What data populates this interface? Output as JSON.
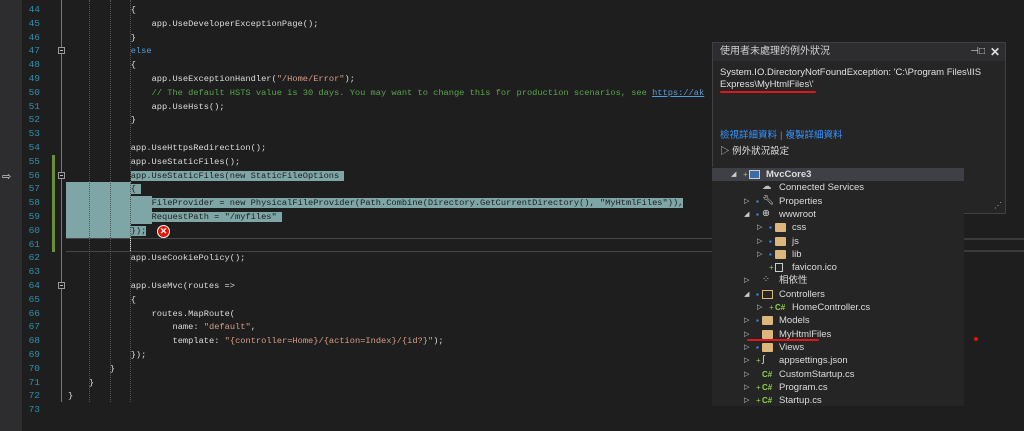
{
  "editor": {
    "lines": [
      {
        "n": "44",
        "indent": 3,
        "tokens": [
          [
            "",
            "{"
          ]
        ]
      },
      {
        "n": "45",
        "indent": 4,
        "tokens": [
          [
            "",
            "app.UseDeveloperExceptionPage();"
          ]
        ]
      },
      {
        "n": "46",
        "indent": 3,
        "tokens": [
          [
            "",
            "}"
          ]
        ]
      },
      {
        "n": "47",
        "indent": 3,
        "tokens": [
          [
            "kw",
            "else"
          ]
        ]
      },
      {
        "n": "48",
        "indent": 3,
        "tokens": [
          [
            "",
            "{"
          ]
        ]
      },
      {
        "n": "49",
        "indent": 4,
        "tokens": [
          [
            "",
            "app.UseExceptionHandler("
          ],
          [
            "str",
            "\"/Home/Error\""
          ],
          [
            "",
            ");"
          ]
        ]
      },
      {
        "n": "50",
        "indent": 4,
        "tokens": [
          [
            "cm",
            "// The default HSTS value is 30 days. You may want to change this for production scenarios, see "
          ],
          [
            "lnk",
            "https://ak"
          ]
        ]
      },
      {
        "n": "51",
        "indent": 4,
        "tokens": [
          [
            "",
            "app.UseHsts();"
          ]
        ]
      },
      {
        "n": "52",
        "indent": 3,
        "tokens": [
          [
            "",
            "}"
          ]
        ]
      },
      {
        "n": "53",
        "indent": 3,
        "tokens": []
      },
      {
        "n": "54",
        "indent": 3,
        "tokens": [
          [
            "",
            "app.UseHttpsRedirection();"
          ]
        ]
      },
      {
        "n": "55",
        "indent": 3,
        "tokens": [
          [
            "",
            "app.UseStaticFiles();"
          ]
        ]
      },
      {
        "n": "56",
        "indent": 3,
        "sel": true,
        "tokens": [
          [
            "",
            "app.UseStaticFiles("
          ],
          [
            "kw",
            "new"
          ],
          [
            "",
            " StaticFileOptions "
          ]
        ]
      },
      {
        "n": "57",
        "indent": 3,
        "sel": true,
        "tokens": [
          [
            "",
            "{ "
          ]
        ]
      },
      {
        "n": "58",
        "indent": 4,
        "sel": true,
        "tokens": [
          [
            "",
            "FileProvider = "
          ],
          [
            "kw",
            "new"
          ],
          [
            "",
            " PhysicalFileProvider(Path.Combine(Directory.GetCurrentDirectory(), "
          ],
          [
            "str",
            "\"MyHtmlFiles\""
          ],
          [
            "",
            ")),"
          ]
        ]
      },
      {
        "n": "59",
        "indent": 4,
        "sel": true,
        "tokens": [
          [
            "",
            "RequestPath = "
          ],
          [
            "str",
            "\"/myfiles\""
          ],
          [
            "",
            " "
          ]
        ]
      },
      {
        "n": "60",
        "indent": 3,
        "sel": true,
        "tokens": [
          [
            "",
            "});"
          ]
        ]
      },
      {
        "n": "61",
        "indent": 3,
        "tokens": []
      },
      {
        "n": "62",
        "indent": 3,
        "tokens": [
          [
            "",
            "app.UseCookiePolicy();"
          ]
        ]
      },
      {
        "n": "63",
        "indent": 3,
        "tokens": []
      },
      {
        "n": "64",
        "indent": 3,
        "tokens": [
          [
            "",
            "app.UseMvc(routes =>"
          ]
        ]
      },
      {
        "n": "65",
        "indent": 3,
        "tokens": [
          [
            "",
            "{"
          ]
        ]
      },
      {
        "n": "66",
        "indent": 4,
        "tokens": [
          [
            "",
            "routes.MapRoute("
          ]
        ]
      },
      {
        "n": "67",
        "indent": 5,
        "tokens": [
          [
            "",
            "name: "
          ],
          [
            "str",
            "\"default\""
          ],
          [
            "",
            ","
          ]
        ]
      },
      {
        "n": "68",
        "indent": 5,
        "tokens": [
          [
            "",
            "template: "
          ],
          [
            "str",
            "\"{controller=Home}/{action=Index}/{id?}\""
          ],
          [
            "",
            ");"
          ]
        ]
      },
      {
        "n": "69",
        "indent": 3,
        "tokens": [
          [
            "",
            "});"
          ]
        ]
      },
      {
        "n": "70",
        "indent": 2,
        "tokens": [
          [
            "",
            "}"
          ]
        ]
      },
      {
        "n": "71",
        "indent": 1,
        "tokens": [
          [
            "",
            "}"
          ]
        ]
      },
      {
        "n": "72",
        "indent": 0,
        "tokens": [
          [
            "",
            "}"
          ]
        ]
      },
      {
        "n": "73",
        "indent": 0,
        "tokens": []
      }
    ]
  },
  "exception_popup": {
    "title": "使用者未處理的例外狀況",
    "message": "System.IO.DirectoryNotFoundException: 'C:\\Program Files\\IIS Express\\MyHtmlFiles\\'",
    "view_details": "檢視詳細資料",
    "copy_details": "複製詳細資料",
    "exception_settings": "例外狀況設定"
  },
  "solution_explorer": {
    "items": [
      {
        "label": "MvcCore3",
        "depth": 0,
        "expand": "open",
        "icon": "project-icon",
        "badge": "+",
        "hl": true,
        "bold": true
      },
      {
        "label": "Connected Services",
        "depth": 1,
        "expand": "",
        "icon": "connected-services-icon"
      },
      {
        "label": "Properties",
        "depth": 1,
        "expand": "closed",
        "icon": "wrench-icon",
        "badge": "lock"
      },
      {
        "label": "wwwroot",
        "depth": 1,
        "expand": "open",
        "icon": "globe-icon",
        "badge": "lock"
      },
      {
        "label": "css",
        "depth": 2,
        "expand": "closed",
        "icon": "folder-icon",
        "badge": "lock"
      },
      {
        "label": "js",
        "depth": 2,
        "expand": "closed",
        "icon": "folder-icon",
        "badge": "lock"
      },
      {
        "label": "lib",
        "depth": 2,
        "expand": "closed",
        "icon": "folder-icon",
        "badge": "lock"
      },
      {
        "label": "favicon.ico",
        "depth": 2,
        "expand": "",
        "icon": "file-icon",
        "badge": "+"
      },
      {
        "label": "相依性",
        "depth": 1,
        "expand": "closed",
        "icon": "dependencies-icon"
      },
      {
        "label": "Controllers",
        "depth": 1,
        "expand": "open",
        "icon": "folder-open-icon",
        "badge": "lock"
      },
      {
        "label": "HomeController.cs",
        "depth": 2,
        "expand": "closed",
        "icon": "csharp-icon",
        "badge": "+"
      },
      {
        "label": "Models",
        "depth": 1,
        "expand": "closed",
        "icon": "folder-icon",
        "badge": "lock"
      },
      {
        "label": "MyHtmlFiles",
        "depth": 1,
        "expand": "closed",
        "icon": "folder-icon"
      },
      {
        "label": "Views",
        "depth": 1,
        "expand": "closed",
        "icon": "folder-icon",
        "badge": "lock"
      },
      {
        "label": "appsettings.json",
        "depth": 1,
        "expand": "closed",
        "icon": "json-icon",
        "badge": "+"
      },
      {
        "label": "CustomStartup.cs",
        "depth": 1,
        "expand": "closed",
        "icon": "csharp-icon"
      },
      {
        "label": "Program.cs",
        "depth": 1,
        "expand": "closed",
        "icon": "csharp-icon",
        "badge": "+"
      },
      {
        "label": "Startup.cs",
        "depth": 1,
        "expand": "closed",
        "icon": "csharp-icon",
        "badge": "+"
      }
    ]
  },
  "colors": {
    "accent_red": "#e0161d",
    "selection": "#7fa6a6",
    "link": "#3794ff"
  }
}
